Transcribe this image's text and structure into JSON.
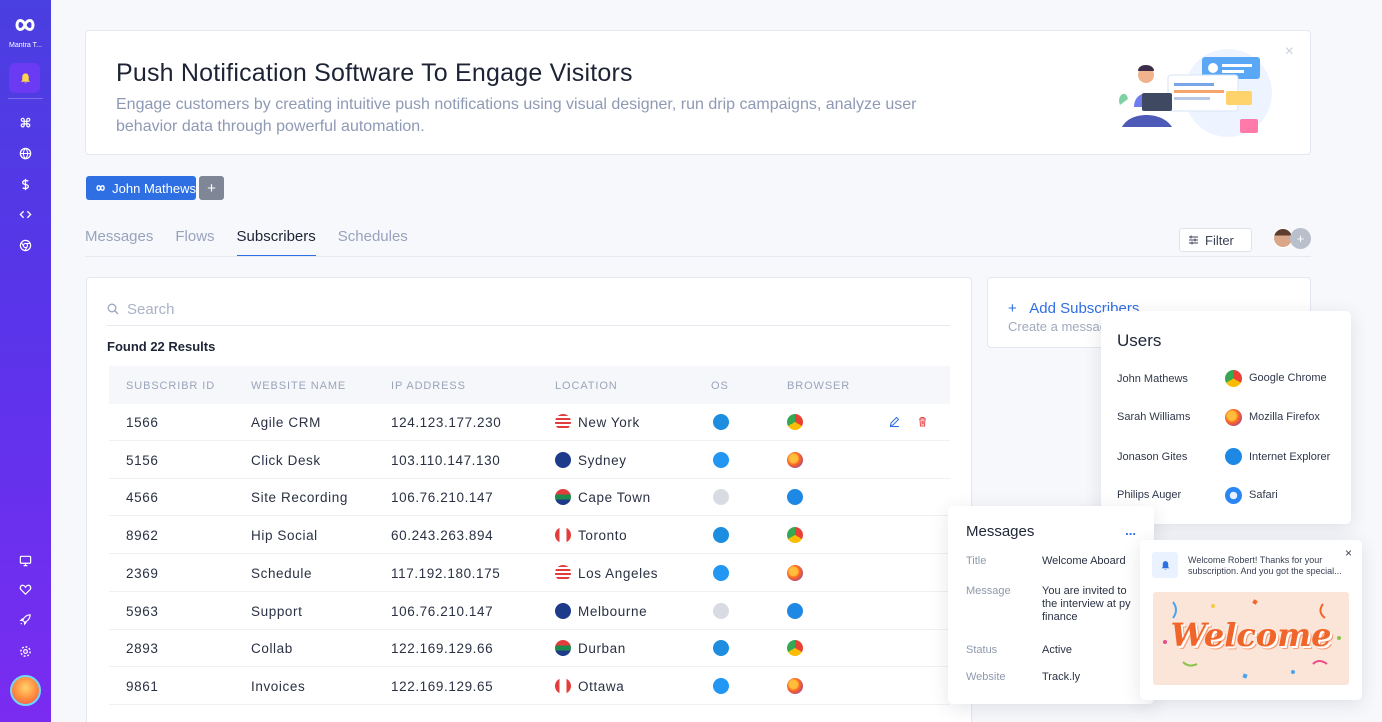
{
  "sidebar": {
    "brand": "Mantra T...",
    "items": [
      {
        "icon": "bell-icon",
        "active": true
      },
      {
        "icon": "command-icon"
      },
      {
        "icon": "globe-icon"
      },
      {
        "icon": "dollar-icon"
      },
      {
        "icon": "code-icon"
      },
      {
        "icon": "chrome-icon"
      }
    ],
    "bottom_items": [
      {
        "icon": "monitor-icon"
      },
      {
        "icon": "heart-icon"
      },
      {
        "icon": "rocket-icon"
      },
      {
        "icon": "settings-icon"
      }
    ]
  },
  "banner": {
    "title": "Push Notification Software To Engage Visitors",
    "subtitle": "Engage customers by creating intuitive push notifications using visual designer, run drip campaigns, analyze user behavior data through powerful automation.",
    "close": "×"
  },
  "account": {
    "name": "John Mathews",
    "add": "+"
  },
  "tabs": [
    "Messages",
    "Flows",
    "Subscribers",
    "Schedules"
  ],
  "active_tab": "Subscribers",
  "toolbar": {
    "filter_label": "Filter",
    "add_member": "+"
  },
  "search": {
    "placeholder": "Search"
  },
  "results": {
    "label": "Found 22 Results"
  },
  "table": {
    "columns": [
      "SUBSCRIBR ID",
      "WEBSITE NAME",
      "IP ADDRESS",
      "LOCATION",
      "OS",
      "BROWSER"
    ],
    "rows": [
      {
        "id": "1566",
        "website": "Agile CRM",
        "ip": "124.123.177.230",
        "location": "New York",
        "flag": "us",
        "os": "windows",
        "browser": "chrome"
      },
      {
        "id": "5156",
        "website": "Click Desk",
        "ip": "103.110.147.130",
        "location": "Sydney",
        "flag": "au",
        "os": "linux",
        "browser": "firefox"
      },
      {
        "id": "4566",
        "website": "Site Recording",
        "ip": "106.76.210.147",
        "location": "Cape Town",
        "flag": "za",
        "os": "apple",
        "browser": "ie"
      },
      {
        "id": "8962",
        "website": "Hip Social",
        "ip": "60.243.263.894",
        "location": "Toronto",
        "flag": "ca",
        "os": "windows",
        "browser": "chrome"
      },
      {
        "id": "2369",
        "website": "Schedule",
        "ip": "117.192.180.175",
        "location": "Los Angeles",
        "flag": "us",
        "os": "linux",
        "browser": "firefox"
      },
      {
        "id": "5963",
        "website": "Support",
        "ip": "106.76.210.147",
        "location": "Melbourne",
        "flag": "au",
        "os": "apple",
        "browser": "ie"
      },
      {
        "id": "2893",
        "website": "Collab",
        "ip": "122.169.129.66",
        "location": "Durban",
        "flag": "za",
        "os": "windows",
        "browser": "chrome"
      },
      {
        "id": "9861",
        "website": "Invoices",
        "ip": "122.169.129.65",
        "location": "Ottawa",
        "flag": "ca",
        "os": "linux",
        "browser": "firefox"
      }
    ]
  },
  "add_subscribers": {
    "title": "Add Subscribers",
    "subtitle": "Create a messag"
  },
  "users_popup": {
    "title": "Users",
    "rows": [
      {
        "name": "John Mathews",
        "browser": "Google Chrome",
        "icon": "chrome"
      },
      {
        "name": "Sarah Williams",
        "browser": "Mozilla Firefox",
        "icon": "firefox"
      },
      {
        "name": "Jonason Gites",
        "browser": "Internet Explorer",
        "icon": "ie"
      },
      {
        "name": "Philips Auger",
        "browser": "Safari",
        "icon": "safari"
      }
    ]
  },
  "messages_popup": {
    "title": "Messages",
    "more": "...",
    "fields": [
      {
        "key": "Title",
        "value": "Welcome Aboard"
      },
      {
        "key": "Message",
        "value": "You are invited to the interview at py finance"
      },
      {
        "key": "Status",
        "value": "Active"
      },
      {
        "key": "Website",
        "value": "Track.ly"
      }
    ]
  },
  "notification": {
    "text": "Welcome Robert! Thanks for your subscription. And you got the special...",
    "close": "×",
    "image_text": "Welcome"
  },
  "colors": {
    "accent": "#2f6fe4",
    "sidebar_top": "#4a3fe0",
    "sidebar_bottom": "#7a2cf0",
    "danger": "#e5484d"
  }
}
